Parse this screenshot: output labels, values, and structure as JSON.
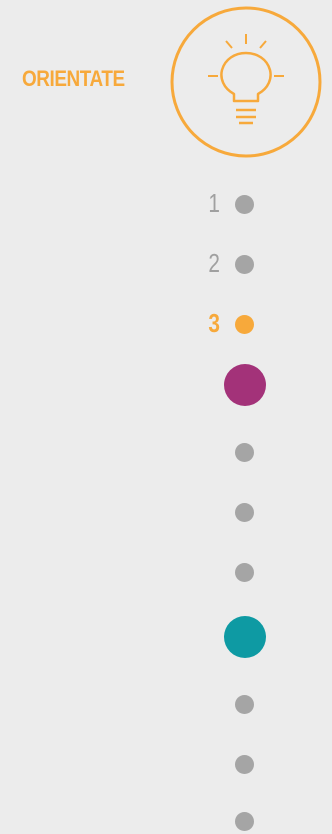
{
  "stage": {
    "label": "ORIENTATE",
    "icon": "lightbulb-icon",
    "color": "#f7a93b"
  },
  "steps": [
    {
      "number": "1",
      "state": "inactive"
    },
    {
      "number": "2",
      "state": "inactive"
    },
    {
      "number": "3",
      "state": "active"
    }
  ],
  "milestones": [
    {
      "color": "#a33279"
    },
    {
      "color": "#0e9aa3"
    }
  ],
  "colors": {
    "accent": "#f7a93b",
    "inactive_dot": "#a5a5a5",
    "background": "#ececec"
  }
}
